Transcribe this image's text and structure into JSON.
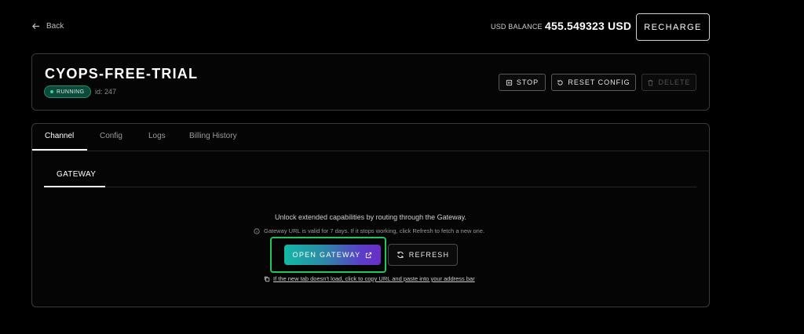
{
  "header": {
    "back_label": "Back",
    "balance_label": "USD BALANCE",
    "balance_value": "455.549323 USD",
    "recharge_label": "RECHARGE"
  },
  "instance": {
    "title": "CYOPS-FREE-TRIAL",
    "status": "RUNNING",
    "id_text": "id: 247",
    "actions": {
      "stop": "STOP",
      "reset": "RESET CONFIG",
      "delete": "DELETE"
    }
  },
  "tabs": [
    {
      "label": "Channel",
      "active": true
    },
    {
      "label": "Config",
      "active": false
    },
    {
      "label": "Logs",
      "active": false
    },
    {
      "label": "Billing History",
      "active": false
    }
  ],
  "gateway": {
    "subtab_label": "GATEWAY",
    "description": "Unlock extended capabilities by routing through the Gateway.",
    "info": "Gateway URL is valid for 7 days. If it stops working, click Refresh to fetch a new one.",
    "open_label": "OPEN GATEWAY",
    "refresh_label": "REFRESH",
    "copy_hint": "If the new tab doesn't load, click to copy URL and paste into your address bar"
  },
  "colors": {
    "background": "#000000",
    "status_running": "#34d399",
    "highlight": "#22c55e",
    "gradient_start": "#14b8a6",
    "gradient_end": "#6a2ec7"
  }
}
